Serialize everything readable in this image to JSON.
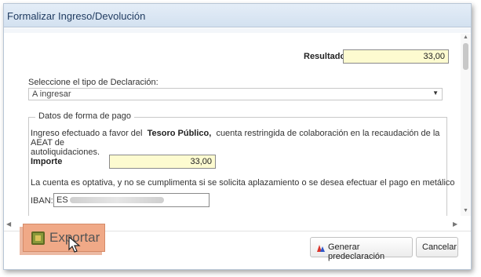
{
  "dialog": {
    "title": "Formalizar Ingreso/Devolución"
  },
  "resultado": {
    "label": "Resultado",
    "value": "33,00"
  },
  "declaracion": {
    "label": "Seleccione el tipo de Declaración:",
    "selected": "A ingresar"
  },
  "pago": {
    "legend": "Datos de forma de pago",
    "info_pre": "Ingreso efectuado a favor del",
    "info_bold": "Tesoro Público,",
    "info_post": "cuenta restringida de colaboración en la recaudación de la AEAT de",
    "info_line2": "autoliquidaciones.",
    "importe_label": "Importe",
    "importe_value": "33,00",
    "optional_note": "La cuenta es optativa, y no se cumplimenta si se solicita aplazamiento o se desea efectuar el pago en metálico",
    "iban_label": "IBAN:",
    "iban_value": "ES"
  },
  "footer": {
    "export_label": "Exportar",
    "generate_label": "Generar predeclaración",
    "cancel_label": "Cancelar"
  },
  "colors": {
    "highlight_field": "#fdfbd0",
    "export_highlight": "#f0a987",
    "title_text": "#1f3a5f"
  },
  "icons": [
    "export-icon",
    "generate-predeclaration-icon",
    "mouse-pointer-icon",
    "dropdown-caret-icon"
  ]
}
